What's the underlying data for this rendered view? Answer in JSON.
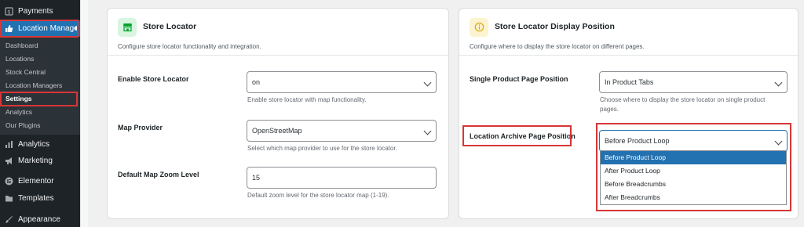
{
  "sidebar": {
    "payments": "Payments",
    "location_manager": "Location Manage",
    "submenu": [
      {
        "label": "Dashboard"
      },
      {
        "label": "Locations"
      },
      {
        "label": "Stock Central"
      },
      {
        "label": "Location Managers"
      },
      {
        "label": "Settings"
      },
      {
        "label": "Analytics"
      },
      {
        "label": "Our Plugins"
      }
    ],
    "analytics": "Analytics",
    "marketing": "Marketing",
    "elementor": "Elementor",
    "templates": "Templates",
    "appearance": "Appearance"
  },
  "store_locator": {
    "title": "Store Locator",
    "subtitle": "Configure store locator functionality and integration.",
    "enable_label": "Enable Store Locator",
    "enable_value": "on",
    "enable_help": "Enable store locator with map functionality.",
    "provider_label": "Map Provider",
    "provider_value": "OpenStreetMap",
    "provider_help": "Select which map provider to use for the store locator.",
    "zoom_label": "Default Map Zoom Level",
    "zoom_value": "15",
    "zoom_help": "Default zoom level for the store locator map (1-19)."
  },
  "display_position": {
    "title": "Store Locator Display Position",
    "subtitle": "Configure where to display the store locator on different pages.",
    "single_label": "Single Product Page Position",
    "single_value": "In Product Tabs",
    "single_help_1": "Choose where to display the store locator on single product",
    "single_help_2": "pages.",
    "archive_label": "Location Archive Page Position",
    "archive_value": "Before Product Loop",
    "archive_options": [
      {
        "label": "Before Product Loop"
      },
      {
        "label": "After Product Loop"
      },
      {
        "label": "Before Breadcrumbs"
      },
      {
        "label": "After Breadcrumbs"
      }
    ]
  },
  "colors": {
    "accent": "#2271b1",
    "highlight": "#d63638",
    "store_badge_bg": "#d7f5df",
    "position_badge_bg": "#fcf3cf"
  }
}
